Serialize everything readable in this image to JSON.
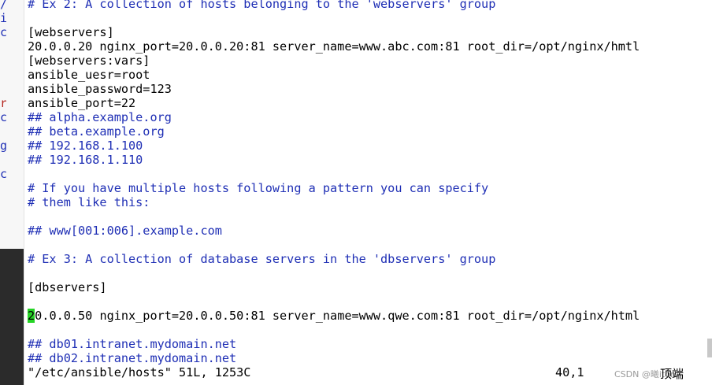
{
  "editor": {
    "lines": [
      {
        "text": "# Ex 2: A collection of hosts belonging to the 'webservers' group",
        "type": "comment"
      },
      {
        "text": "",
        "type": "normal"
      },
      {
        "text": "[webservers]",
        "type": "normal"
      },
      {
        "text": "20.0.0.20 nginx_port=20.0.0.20:81 server_name=www.abc.com:81 root_dir=/opt/nginx/hmtl",
        "type": "normal"
      },
      {
        "text": "[webservers:vars]",
        "type": "normal"
      },
      {
        "text": "ansible_uesr=root",
        "type": "normal"
      },
      {
        "text": "ansible_password=123",
        "type": "normal"
      },
      {
        "text": "ansible_port=22",
        "type": "normal"
      },
      {
        "text": "## alpha.example.org",
        "type": "comment"
      },
      {
        "text": "## beta.example.org",
        "type": "comment"
      },
      {
        "text": "## 192.168.1.100",
        "type": "comment"
      },
      {
        "text": "## 192.168.1.110",
        "type": "comment"
      },
      {
        "text": "",
        "type": "normal"
      },
      {
        "text": "# If you have multiple hosts following a pattern you can specify",
        "type": "comment"
      },
      {
        "text": "# them like this:",
        "type": "comment"
      },
      {
        "text": "",
        "type": "normal"
      },
      {
        "text": "## www[001:006].example.com",
        "type": "comment"
      },
      {
        "text": "",
        "type": "normal"
      },
      {
        "text": "# Ex 3: A collection of database servers in the 'dbservers' group",
        "type": "comment"
      },
      {
        "text": "",
        "type": "normal"
      },
      {
        "text": "[dbservers]",
        "type": "normal"
      },
      {
        "text": "",
        "type": "normal"
      },
      {
        "text": "20.0.0.50 nginx_port=20.0.0.50:81 server_name=www.qwe.com:81 root_dir=/opt/nginx/html",
        "type": "cursor"
      },
      {
        "text": "",
        "type": "normal"
      },
      {
        "text": "## db01.intranet.mydomain.net",
        "type": "comment"
      },
      {
        "text": "## db02.intranet.mydomain.net",
        "type": "comment"
      }
    ],
    "cursor_char": "2",
    "cursor_rest": "0.0.0.50 nginx_port=20.0.0.50:81 server_name=www.qwe.com:81 root_dir=/opt/nginx/html"
  },
  "status": {
    "file": "\"/etc/ansible/hosts\" 51L, 1253C",
    "position": "40,1",
    "scroll": "顶端"
  },
  "watermark": {
    "text": "CSDN @曦itom"
  },
  "gutter": {
    "glyphs": [
      "/",
      "i",
      "c",
      "",
      "",
      "",
      "",
      "r",
      "c",
      "",
      "g",
      "",
      "c"
    ]
  },
  "colors": {
    "comment": "#1f2fb5",
    "cursor": "#25d425",
    "text": "#000000",
    "background": "#ffffff"
  }
}
